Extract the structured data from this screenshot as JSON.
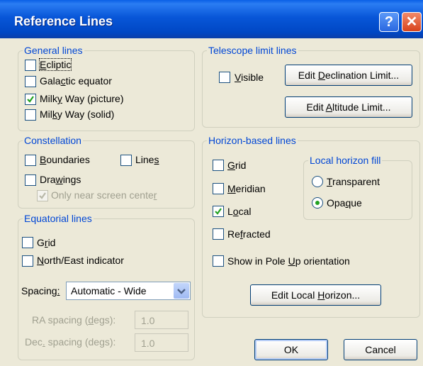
{
  "window": {
    "title": "Reference Lines",
    "help_glyph": "?",
    "close_glyph": "✕"
  },
  "general": {
    "legend": "General lines",
    "items": [
      {
        "pre": "",
        "u": "E",
        "post": "cliptic",
        "checked": false
      },
      {
        "pre": "Gala",
        "u": "c",
        "post": "tic equator",
        "checked": false
      },
      {
        "pre": "Milk",
        "u": "y",
        "post": " Way (picture)",
        "checked": true
      },
      {
        "pre": "Mil",
        "u": "k",
        "post": "y Way (solid)",
        "checked": false
      }
    ]
  },
  "constellation": {
    "legend": "Constellation",
    "boundaries": {
      "pre": "",
      "u": "B",
      "post": "oundaries",
      "checked": false
    },
    "lines": {
      "pre": "Line",
      "u": "s",
      "post": "",
      "checked": false
    },
    "drawings": {
      "pre": "Dra",
      "u": "w",
      "post": "ings",
      "checked": false
    },
    "near_center": {
      "pre": "Only near screen cente",
      "u": "r",
      "post": "",
      "checked": true,
      "disabled": true
    }
  },
  "equatorial": {
    "legend": "Equatorial lines",
    "grid": {
      "pre": "G",
      "u": "r",
      "post": "id",
      "checked": false
    },
    "ne": {
      "pre": "",
      "u": "N",
      "post": "orth/East indicator",
      "checked": false
    },
    "spacing_label_pre": "Spacing",
    "spacing_label_u": ":",
    "spacing_value": "Automatic - Wide",
    "ra_label": {
      "pre": "RA spacing (",
      "u": "d",
      "post": "egs):"
    },
    "ra_value": "1.0",
    "dec_label": {
      "pre": "Dec",
      "u": ".",
      "post": " spacing (degs):"
    },
    "dec_value": "1.0"
  },
  "telescope": {
    "legend": "Telescope limit lines",
    "visible": {
      "pre": "",
      "u": "V",
      "post": "isible",
      "checked": false
    },
    "edit_dec": {
      "pre": "Edit ",
      "u": "D",
      "post": "eclination Limit..."
    },
    "edit_alt": {
      "pre": "Edit ",
      "u": "A",
      "post": "ltitude Limit..."
    }
  },
  "horizon": {
    "legend": "Horizon-based lines",
    "grid": {
      "pre": "",
      "u": "G",
      "post": "rid",
      "checked": false
    },
    "meridian": {
      "pre": "",
      "u": "M",
      "post": "eridian",
      "checked": false
    },
    "local": {
      "pre": "L",
      "u": "o",
      "post": "cal",
      "checked": true
    },
    "refracted": {
      "pre": "Re",
      "u": "f",
      "post": "racted",
      "checked": false
    },
    "pole_up": {
      "pre": "Show in Pole ",
      "u": "U",
      "post": "p orientation",
      "checked": false
    },
    "fill_legend": "Local horizon fill",
    "transparent": {
      "pre": "",
      "u": "T",
      "post": "ransparent",
      "selected": false
    },
    "opaque": {
      "pre": "Opa",
      "u": "q",
      "post": "ue",
      "selected": true
    },
    "edit_local": {
      "pre": "Edit Local ",
      "u": "H",
      "post": "orizon..."
    }
  },
  "footer": {
    "ok": "OK",
    "cancel": "Cancel"
  },
  "colors": {
    "legend": "#0046d5",
    "check": "#21a121",
    "title_blue": "#0856d8",
    "close_red": "#d8431b"
  }
}
